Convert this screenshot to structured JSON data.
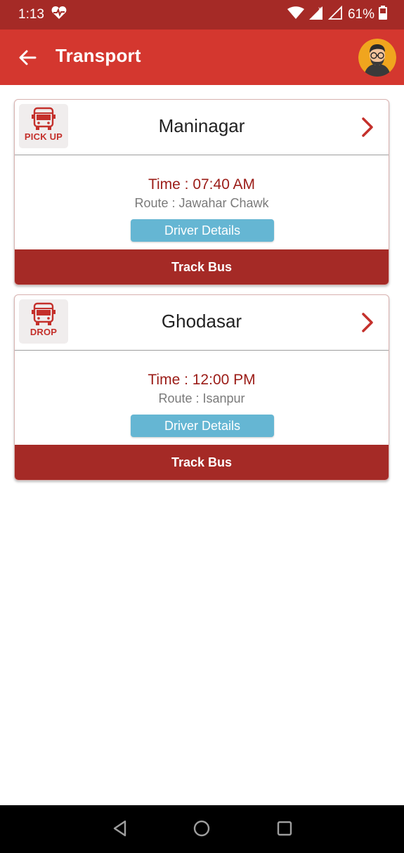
{
  "status_bar": {
    "time": "1:13",
    "battery": "61%",
    "icons": [
      "heart-pulse-icon",
      "wifi-icon",
      "signal-icon",
      "signal-empty-icon",
      "battery-icon"
    ]
  },
  "app_bar": {
    "title": "Transport",
    "back_icon": "arrow-left-icon",
    "avatar": "user-avatar"
  },
  "colors": {
    "primary": "#d4372f",
    "primary_dark": "#a52a26",
    "time_text": "#9b1c17",
    "driver_button": "#65b6d3"
  },
  "cards": [
    {
      "type_label": "PICK UP",
      "location": "Maninagar",
      "time": "Time : 07:40 AM",
      "route": "Route : Jawahar Chawk",
      "driver_button": "Driver Details",
      "track_button": "Track Bus"
    },
    {
      "type_label": "DROP",
      "location": "Ghodasar",
      "time": "Time : 12:00 PM",
      "route": "Route : Isanpur",
      "driver_button": "Driver Details",
      "track_button": "Track Bus"
    }
  ],
  "nav_bar": {
    "buttons": [
      "back-triangle-icon",
      "home-circle-icon",
      "recents-square-icon"
    ]
  }
}
